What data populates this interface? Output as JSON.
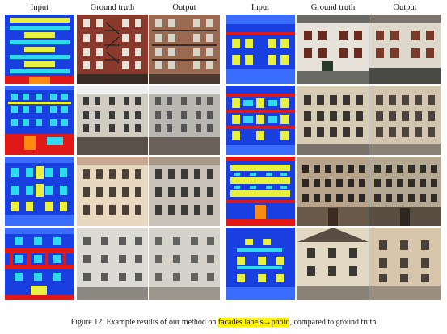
{
  "left_headers": [
    "Input",
    "Ground truth",
    "Output"
  ],
  "right_headers": [
    "Input",
    "Ground truth",
    "Output"
  ],
  "caption": {
    "before": "Figure 12: Example results of our method on ",
    "highlight": "facades labels→photo",
    "after": ", compared to ground truth"
  },
  "colors": {
    "label_bg": "#1a3fe0",
    "label_blue2": "#3a6cff",
    "label_cyan": "#2fd9f2",
    "label_yellow": "#e8f040",
    "label_orange": "#ff8a10",
    "label_red": "#e01818",
    "highlight": "#fff200"
  }
}
